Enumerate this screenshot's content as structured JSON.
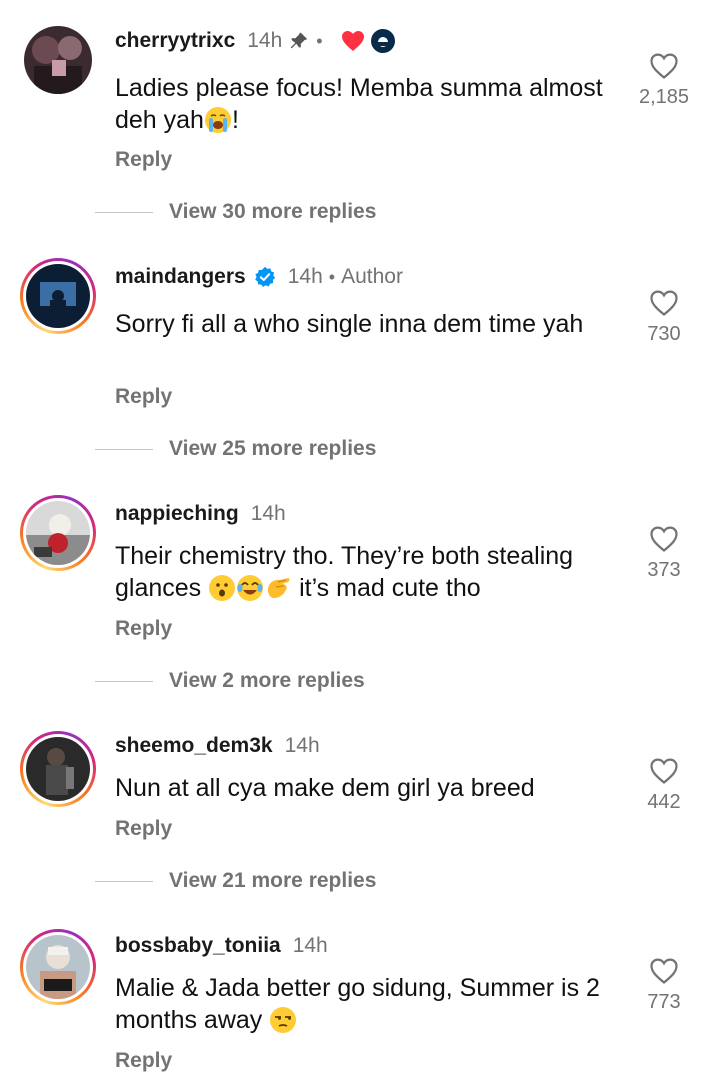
{
  "comments": [
    {
      "username": "cherryytrixc",
      "time": "14h",
      "text_parts": [
        "Ladies please focus! Memba summa almost deh yah",
        "!"
      ],
      "reply_label": "Reply",
      "more_replies": "View 30 more replies",
      "likes": "2,185",
      "icons": [
        "pin-icon",
        "red-heart-icon",
        "creator-avatar-icon"
      ]
    },
    {
      "username": "maindangers",
      "time": "14h",
      "author_label": "Author",
      "text": "Sorry fi all a who single inna dem time yah",
      "reply_label": "Reply",
      "more_replies": "View 25 more replies",
      "likes": "730",
      "icons": [
        "verified-badge-icon"
      ]
    },
    {
      "username": "nappieching",
      "time": "14h",
      "text_parts": [
        "Their chemistry tho. They’re both stealing glances ",
        " it’s mad cute tho"
      ],
      "reply_label": "Reply",
      "more_replies": "View 2 more replies",
      "likes": "373"
    },
    {
      "username": "sheemo_dem3k",
      "time": "14h",
      "text": "Nun at all cya make dem girl ya breed",
      "reply_label": "Reply",
      "more_replies": "View 21 more replies",
      "likes": "442"
    },
    {
      "username": "bossbaby_toniia",
      "time": "14h",
      "text_parts": [
        "Malie & Jada better go sidung, Summer is 2 months away "
      ],
      "reply_label": "Reply",
      "likes": "773"
    }
  ],
  "colors": {
    "secondary_text": "#737373",
    "primary_text": "#111111",
    "verified_blue": "#0095f6",
    "red_heart": "#ff3040"
  }
}
